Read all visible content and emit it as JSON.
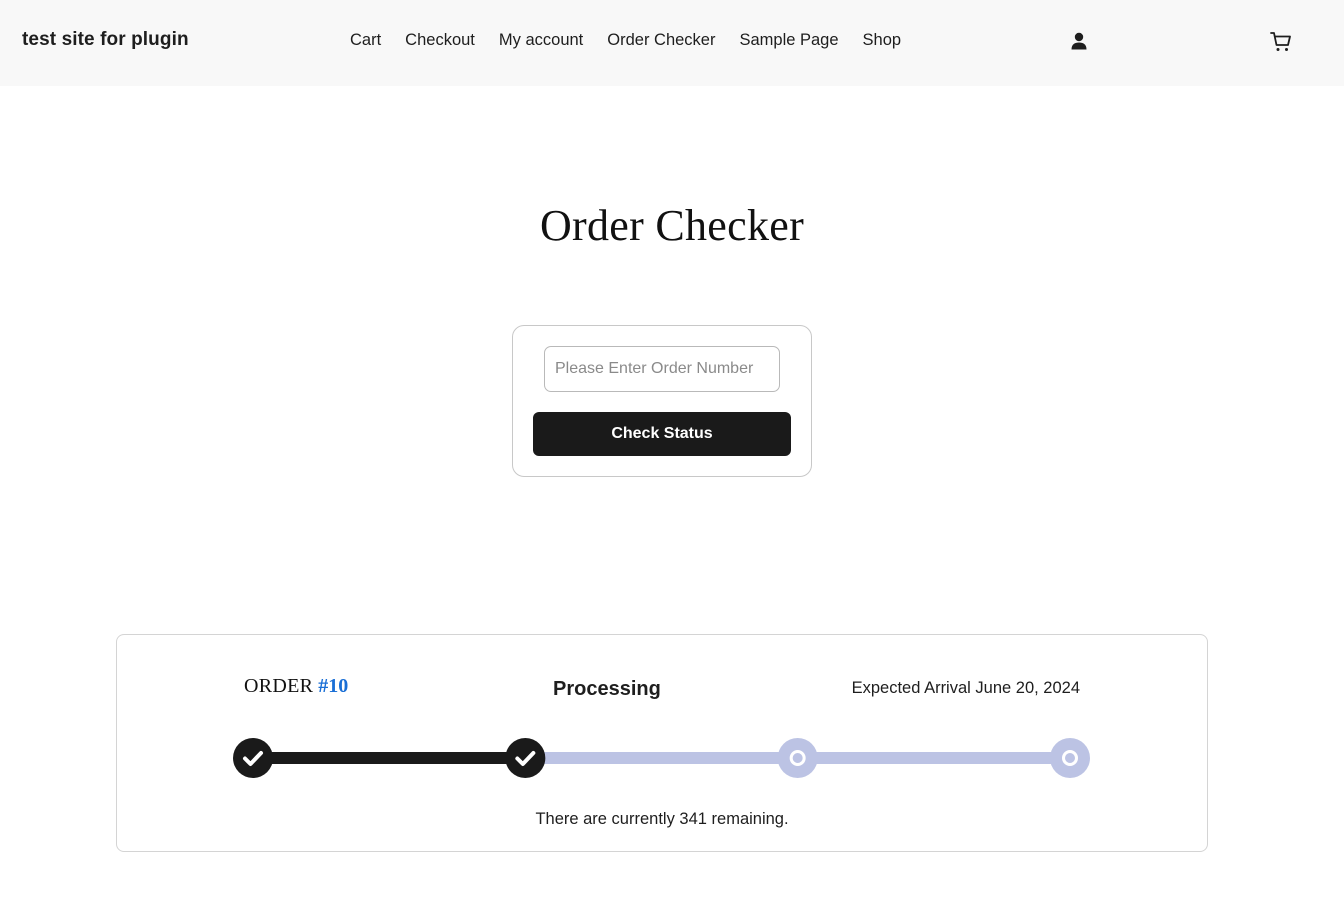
{
  "header": {
    "site_title": "test site for plugin",
    "nav": [
      {
        "label": "Cart"
      },
      {
        "label": "Checkout"
      },
      {
        "label": "My account"
      },
      {
        "label": "Order Checker"
      },
      {
        "label": "Sample Page"
      },
      {
        "label": "Shop"
      }
    ],
    "icons": [
      "account-icon",
      "cart-icon"
    ]
  },
  "main": {
    "title": "Order Checker",
    "form": {
      "input_placeholder": "Please Enter Order Number",
      "input_value": "",
      "button_label": "Check Status"
    },
    "order_status": {
      "order_word": "ORDER",
      "order_number": "#10",
      "status": "Processing",
      "expected_arrival": "Expected Arrival June 20, 2024",
      "remaining": "There are currently 341 remaining.",
      "steps_total": 4,
      "steps_completed": 2,
      "colors": {
        "complete": "#1a1a1a",
        "pending": "#bcc3e4",
        "order_number": "#1a6fd6"
      }
    }
  }
}
